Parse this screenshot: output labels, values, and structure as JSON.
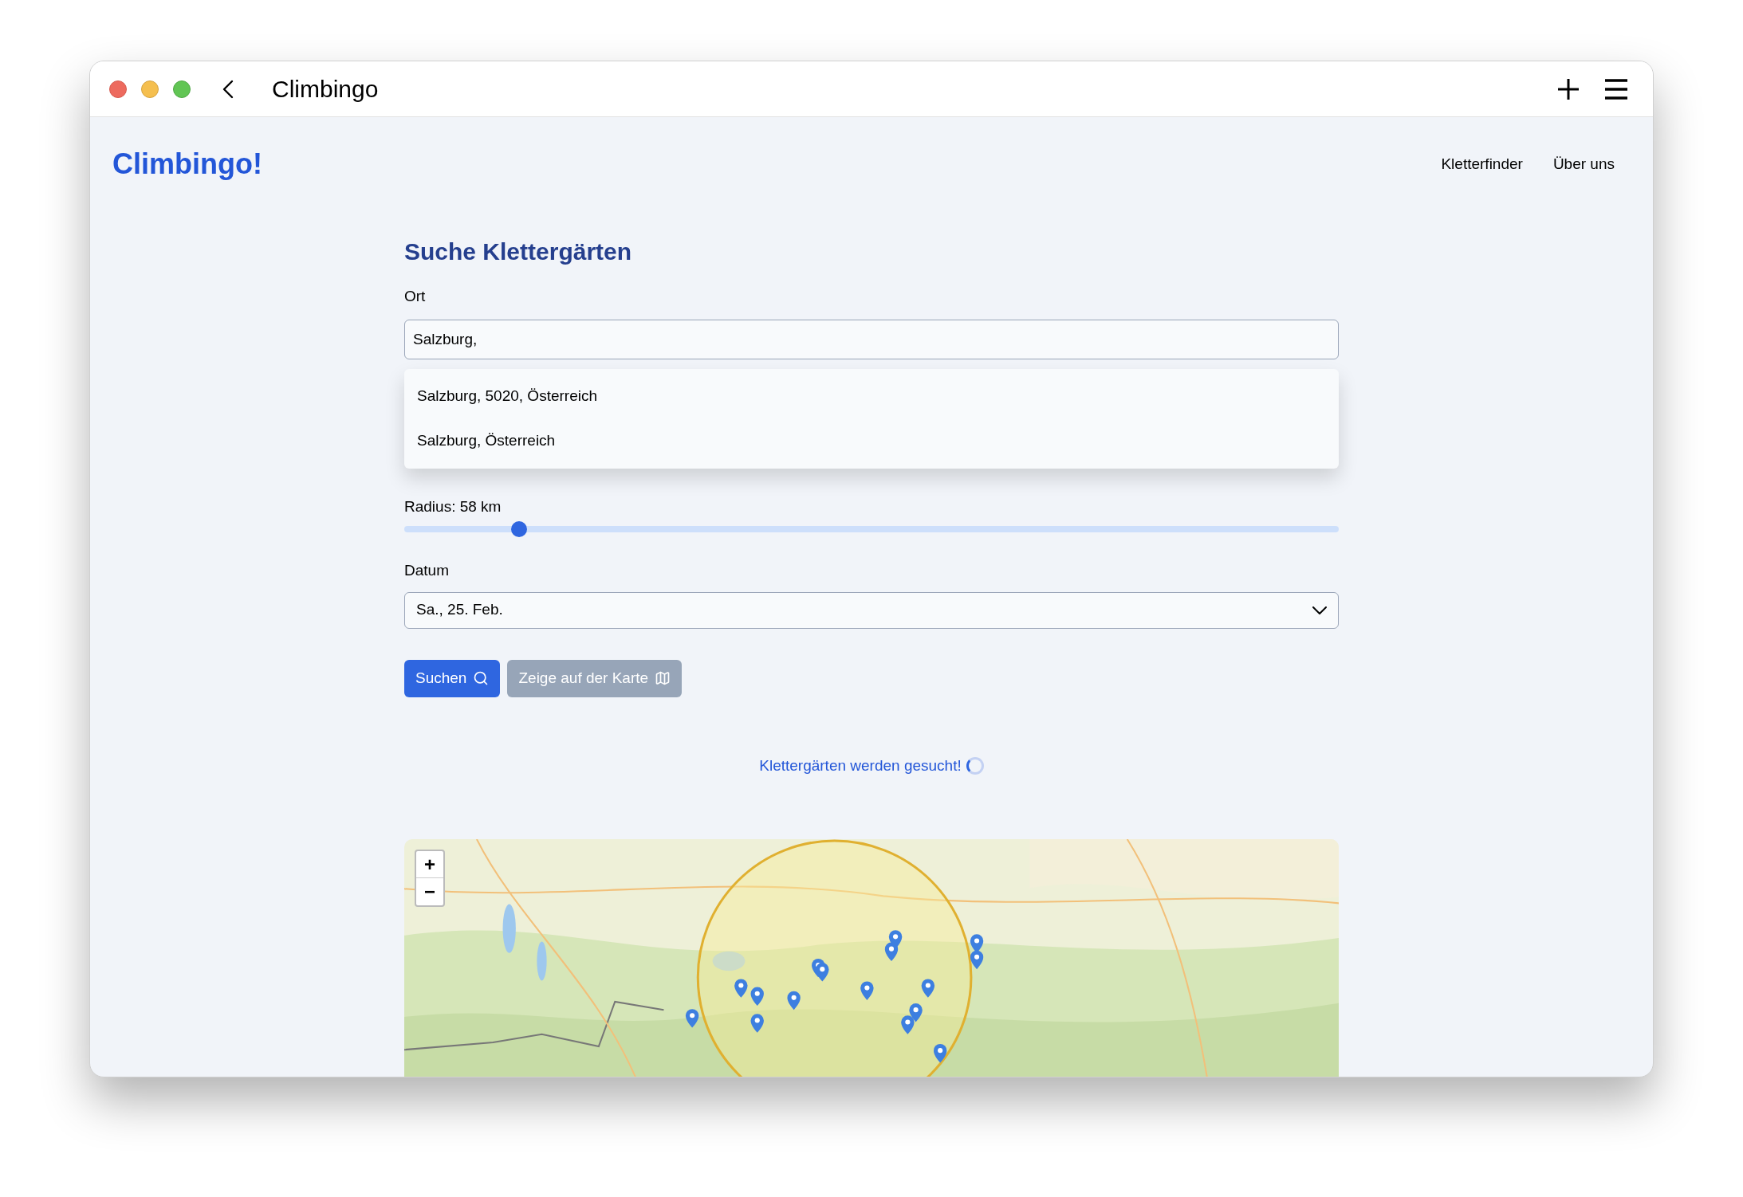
{
  "window": {
    "title": "Climbingo"
  },
  "header": {
    "logo": "Climbingo!",
    "nav": [
      {
        "label": "Kletterfinder"
      },
      {
        "label": "Über uns"
      }
    ]
  },
  "search": {
    "heading": "Suche Klettergärten",
    "location": {
      "label": "Ort",
      "value": "Salzburg,"
    },
    "suggestions": [
      {
        "label": "Salzburg, 5020, Österreich"
      },
      {
        "label": "Salzburg, Österreich"
      }
    ],
    "radius": {
      "label": "Radius: 58 km",
      "level": 0.123
    },
    "date": {
      "label": "Datum",
      "value": "Sa., 25. Feb."
    },
    "buttons": [
      {
        "label": "Suchen",
        "kind": "search",
        "disabled": false
      },
      {
        "label": "Zeige auf der Karte",
        "kind": "map",
        "disabled": true
      }
    ],
    "status": "Klettergärten werden gesucht!"
  },
  "map": {
    "kind": "picture",
    "zoom_buttons": [
      "+",
      "−"
    ]
  }
}
